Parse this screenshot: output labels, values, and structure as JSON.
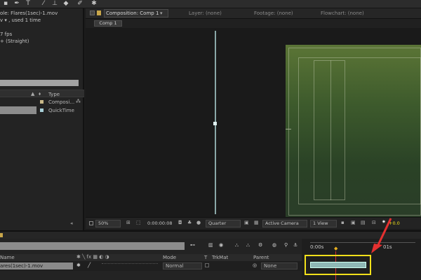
{
  "toolbar": {
    "tools": [
      "selection-tool",
      "pen-tool",
      "type-tool",
      "brush-tool",
      "clone-tool",
      "eraser-tool",
      "roto-tool",
      "puppet-tool"
    ]
  },
  "project": {
    "title_text": "ole: Flares(1sec)-1.mov",
    "used_text": "v ▾ , used 1 time",
    "fps_text": "7 fps",
    "alpha_text": "+ (Straight)",
    "col_type": "Type",
    "rows": [
      {
        "type": "Composi…",
        "color": "#c8b888"
      },
      {
        "type": "QuickTime",
        "color": "#a8d0d8"
      }
    ]
  },
  "comp_tabs": {
    "composition": "Composition: Comp 1",
    "layer": "Layer: (none)",
    "footage": "Footage: (none)",
    "flowchart": "Flowchart: (none)",
    "sub_tab": "Comp 1"
  },
  "viewer_bar": {
    "zoom": "50%",
    "timecode": "0:00:00:08",
    "resolution": "Quarter",
    "camera": "Active Camera",
    "views": "1 View",
    "exposure": "+0.0"
  },
  "timeline": {
    "col_mode": "Mode",
    "col_t": "T",
    "col_trkmat": "TrkMat",
    "col_parent": "Parent",
    "col_name": "Name",
    "time_start": "0:00s",
    "time_mark": "01s",
    "layer": {
      "name": "ares(1sec)-1.mov",
      "mode": "Normal",
      "parent": "None"
    }
  },
  "colors": {
    "highlight": "#f2e01a",
    "arrow": "#e53030",
    "comp_green": "#5b7536"
  }
}
